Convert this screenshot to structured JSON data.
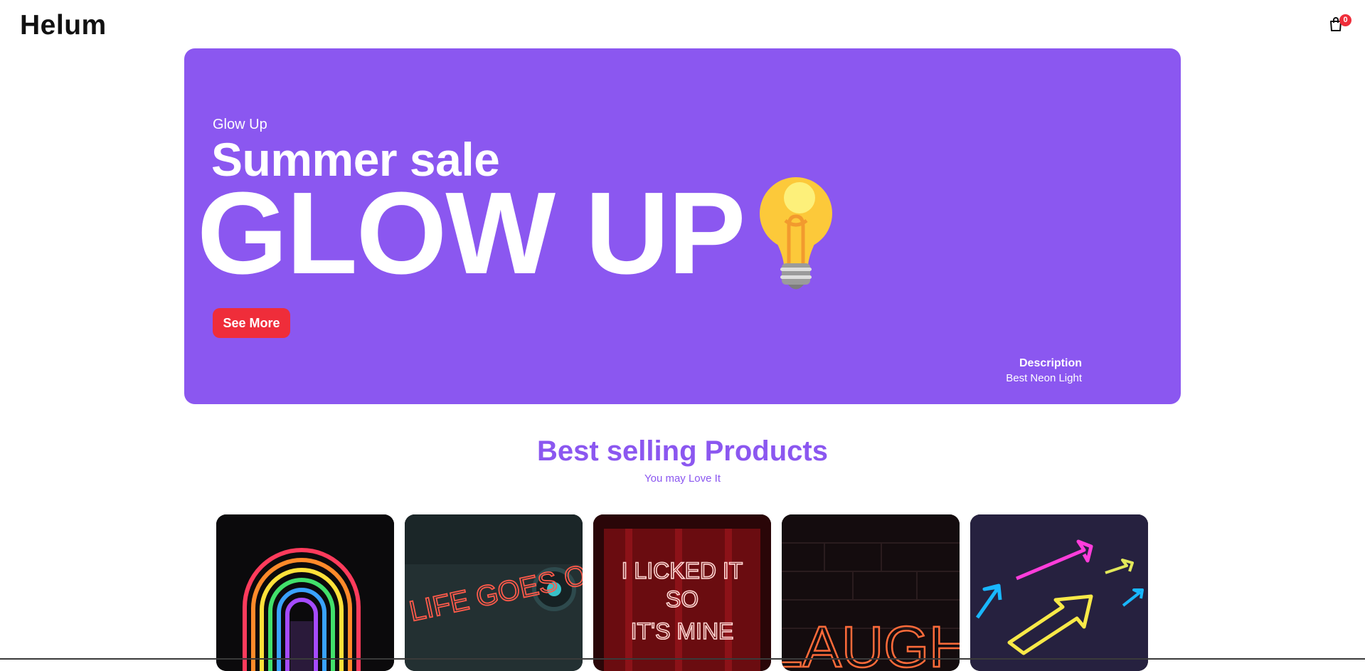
{
  "header": {
    "logo": "Helum",
    "cart_count": "0",
    "cart_icon": "shopping-bag-icon"
  },
  "hero": {
    "kicker": "Glow Up",
    "subtitle": "Summer sale",
    "title": "GLOW UP",
    "button_label": "See More",
    "description_title": "Description",
    "description_text": "Best Neon Light",
    "image": "light-bulb-illustration",
    "colors": {
      "background": "#8b57f0",
      "button": "#ef2d3a"
    }
  },
  "best_selling": {
    "title": "Best selling Products",
    "subtitle": "You may Love It",
    "products": [
      {
        "image": "rainbow-neon-arches"
      },
      {
        "image": "life-goes-on-neon-sign",
        "sign_text": "LIFE GOES ON"
      },
      {
        "image": "i-licked-it-so-its-mine-neon-sign",
        "sign_text": [
          "I LICKED IT",
          "SO",
          "IT'S MINE"
        ]
      },
      {
        "image": "laugh-neon-sign",
        "sign_text": "LAUGH"
      },
      {
        "image": "neon-arrows"
      }
    ]
  }
}
